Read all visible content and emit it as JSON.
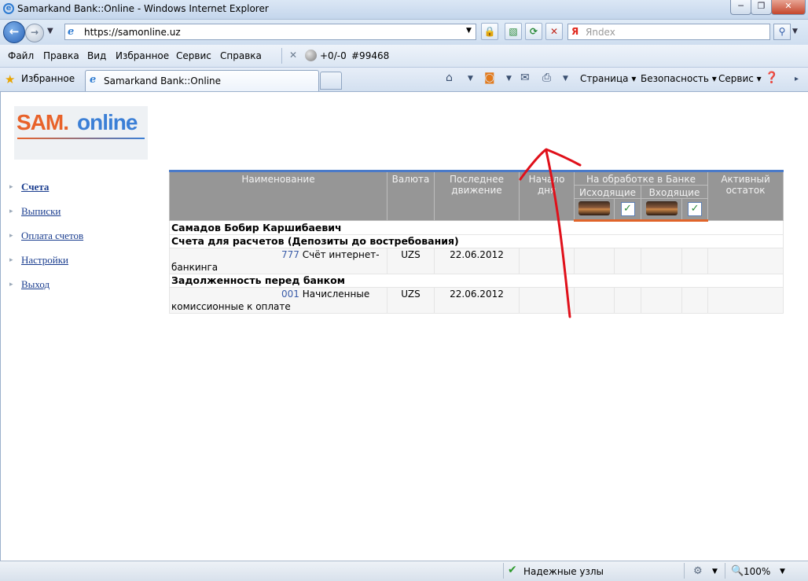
{
  "window": {
    "title": "Samarkand Bank::Online - Windows Internet Explorer",
    "minimize": "─",
    "maximize": "❐",
    "close": "✕"
  },
  "address_bar": {
    "url": "https://samonline.uz",
    "search_placeholder": "Яndex",
    "search_brand": "Я"
  },
  "menu": [
    "Файл",
    "Правка",
    "Вид",
    "Избранное",
    "Сервис",
    "Справка"
  ],
  "toolbar": {
    "counter": "+0/-0",
    "rank": "#99468"
  },
  "favorites": {
    "label": "Избранное",
    "tab_title": "Samarkand Bank::Online",
    "commands": [
      "Страница ▾",
      "Безопасность ▾",
      "Сервис ▾"
    ]
  },
  "logo": {
    "part1": "SAM.",
    "part2": "online"
  },
  "nav": [
    "Счета",
    "Выписки",
    "Оплата счетов",
    "Настройки",
    "Выход"
  ],
  "table": {
    "headers": {
      "name": "Наименование",
      "currency": "Валюта",
      "last_move": "Последнее движение",
      "start": "Начало дня",
      "processing": "На обработке в Банке",
      "outgoing": "Исходящие",
      "incoming": "Входящие",
      "active": "Активный остаток"
    },
    "holder": "Самадов Бобир Каршибаевич",
    "groups": [
      {
        "title": "Счета для расчетов (Депозиты до востребования)",
        "rows": [
          {
            "num": "777",
            "name": "Счёт интернет-банкинга",
            "currency": "UZS",
            "date": "22.06.2012"
          }
        ]
      },
      {
        "title": "Задолженность перед банком",
        "rows": [
          {
            "num": "001",
            "name": "Начисленные комиссионные к оплате",
            "currency": "UZS",
            "date": "22.06.2012"
          }
        ]
      }
    ]
  },
  "status": {
    "trusted": "Надежные узлы",
    "zoom": "100%"
  },
  "icons": {
    "browser": "ie-icon",
    "back": "back-arrow-icon",
    "forward": "forward-arrow-icon",
    "lock": "lock-icon",
    "refresh": "refresh-icon",
    "stop": "stop-icon",
    "search": "search-icon",
    "favorites": "star-icon",
    "home": "home-icon",
    "feed": "rss-icon",
    "mail": "mail-icon",
    "print": "printer-icon",
    "help": "help-icon"
  },
  "colors": {
    "logo_orange": "#e8622a",
    "logo_blue": "#3b7fd6",
    "header_gray": "#969696",
    "annotation_red": "#e0101a"
  }
}
